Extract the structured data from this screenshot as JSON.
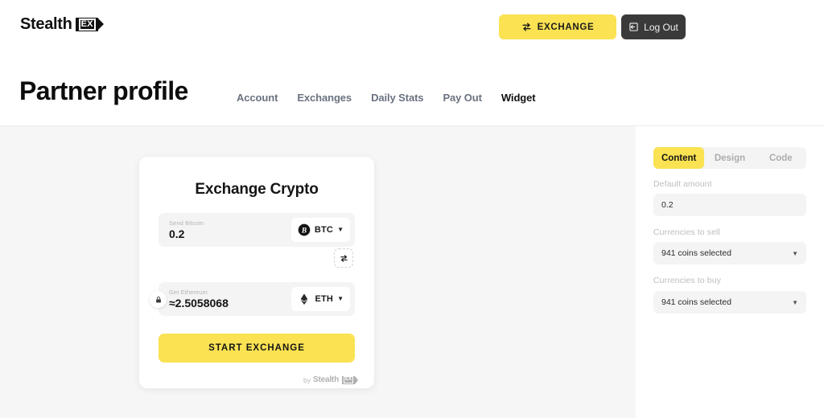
{
  "brand": {
    "name": "Stealth",
    "badge": "EX"
  },
  "header": {
    "exchange_button": "EXCHANGE",
    "exchange_icon": "swap-arrows-icon",
    "logout_button": "Log Out",
    "logout_icon": "logout-icon"
  },
  "page": {
    "title": "Partner profile"
  },
  "nav": {
    "items": [
      {
        "label": "Account",
        "active": false
      },
      {
        "label": "Exchanges",
        "active": false
      },
      {
        "label": "Daily Stats",
        "active": false
      },
      {
        "label": "Pay Out",
        "active": false
      },
      {
        "label": "Widget",
        "active": true
      }
    ]
  },
  "widget": {
    "title": "Exchange Crypto",
    "send": {
      "label": "Send Bitcoin",
      "value": "0.2",
      "coin_ticker": "BTC",
      "coin_icon": "bitcoin-icon",
      "caret": "▼"
    },
    "swap_icon": "swap-arrows-icon",
    "get": {
      "label": "Get Ethereum",
      "value": "≈2.5058068",
      "coin_ticker": "ETH",
      "coin_icon": "ethereum-icon",
      "caret": "▼",
      "lock_icon": "lock-icon"
    },
    "start_button": "START EXCHANGE",
    "footer_by": "by",
    "footer_brand": "Stealth",
    "footer_badge": "EX"
  },
  "settings": {
    "tabs": [
      {
        "label": "Content",
        "active": true
      },
      {
        "label": "Design",
        "active": false
      },
      {
        "label": "Code",
        "active": false
      }
    ],
    "default_amount": {
      "label": "Default amount",
      "value": "0.2"
    },
    "currencies_to_sell": {
      "label": "Currencies to sell",
      "value": "941 coins selected",
      "caret": "▼"
    },
    "currencies_to_buy": {
      "label": "Currencies to buy",
      "value": "941 coins selected",
      "caret": "▼"
    }
  },
  "colors": {
    "accent_yellow": "#FAE252",
    "dark": "#3a3a3a",
    "pane_gray": "#f6f6f6",
    "field_gray": "#f4f4f4"
  }
}
